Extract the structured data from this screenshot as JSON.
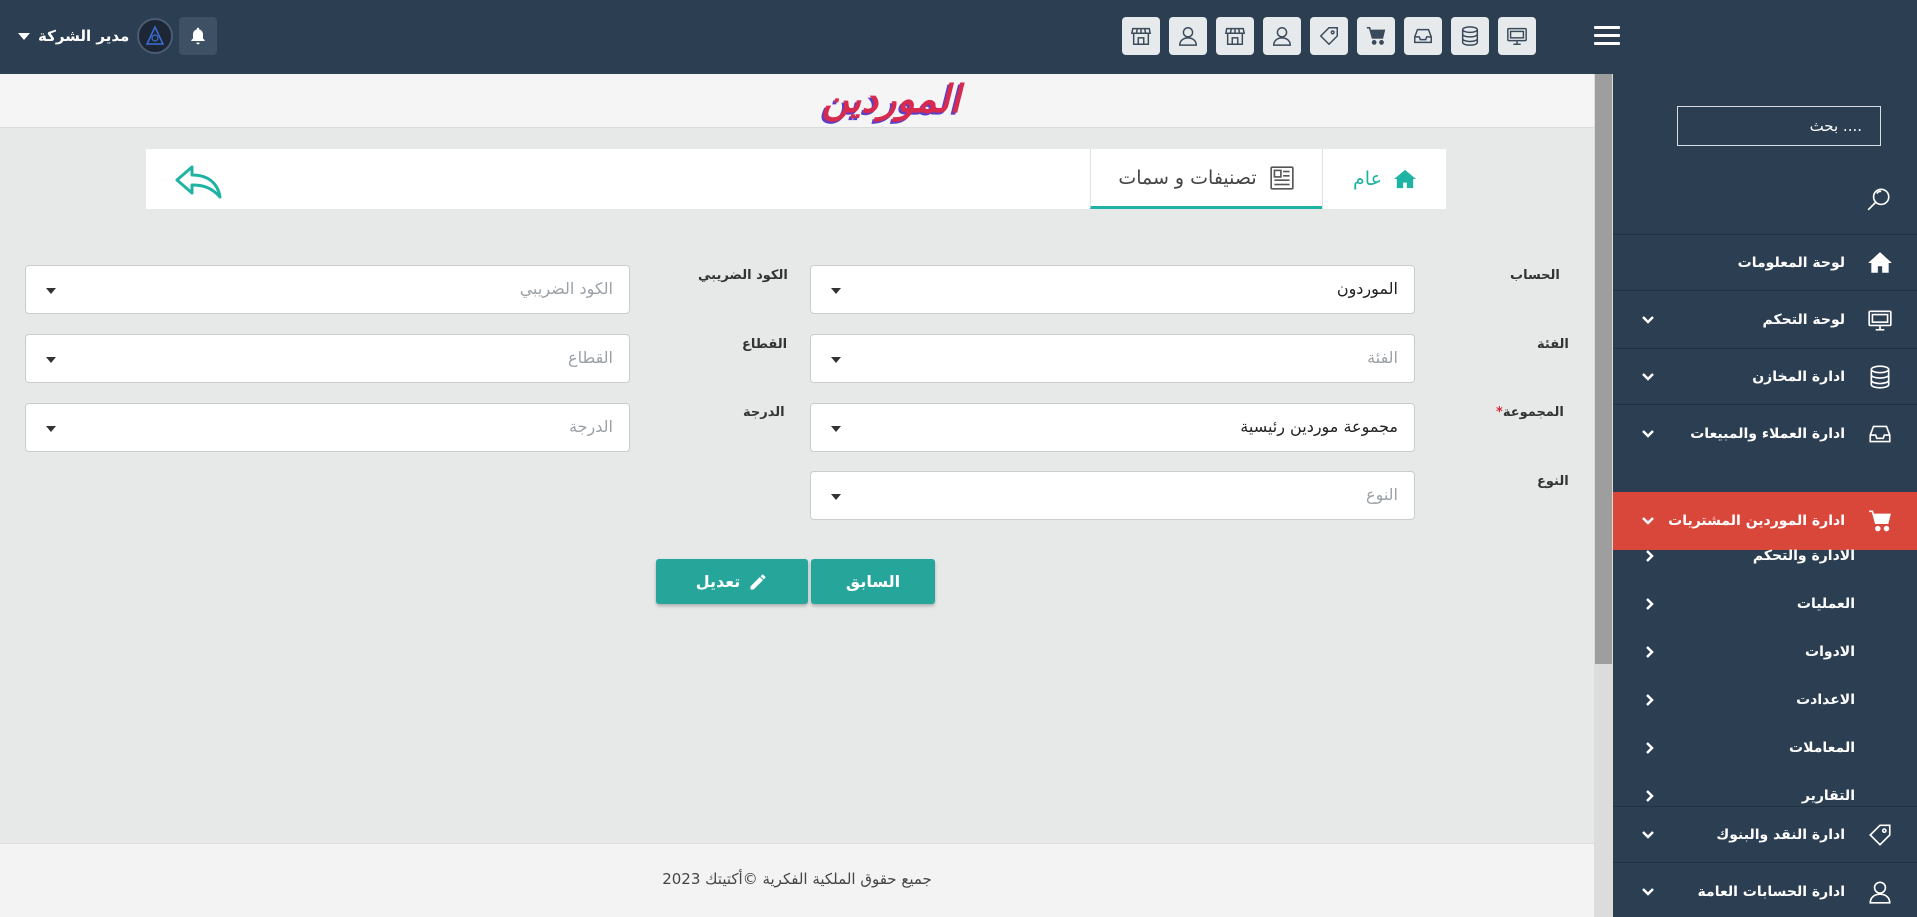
{
  "topbar": {
    "user_name": "مدير الشركة",
    "tool_icons": [
      "monitor-icon",
      "database-icon",
      "inbox-icon",
      "cart-icon",
      "tag-icon",
      "user-icon",
      "store-icon",
      "user-icon",
      "store-icon"
    ]
  },
  "page": {
    "title": "الموردين"
  },
  "tabs": {
    "general": "عام",
    "classifications": "تصنيفات و سمات"
  },
  "form": {
    "account": {
      "label": "الحساب",
      "value": "الموردون"
    },
    "category": {
      "label": "الفئة",
      "placeholder": "الفئة"
    },
    "group": {
      "label": "المجموعة",
      "required_mark": "*",
      "value": "مجموعة موردين رئيسية"
    },
    "type": {
      "label": "النوع",
      "placeholder": "النوع"
    },
    "tax_code": {
      "label": "الكود الضريبي",
      "placeholder": "الكود الضريبي"
    },
    "sector": {
      "label": "القطاع",
      "placeholder": "القطاع"
    },
    "grade": {
      "label": "الدرجة",
      "placeholder": "الدرجة"
    }
  },
  "buttons": {
    "previous": "السابق",
    "edit": "تعديل"
  },
  "footer": {
    "copyright": "جميع حقوق الملكية الفكرية ©أكتيتك 2023"
  },
  "sidebar": {
    "search_placeholder": "بحث ....",
    "items": [
      {
        "label": "لوحة المعلومات",
        "icon": "home-icon"
      },
      {
        "label": "لوحة التحكم",
        "icon": "monitor-icon"
      },
      {
        "label": "ادارة المخازن",
        "icon": "database-icon"
      },
      {
        "label": "ادارة العملاء والمبيعات",
        "icon": "inbox-icon"
      },
      {
        "label": "ادارة الموردين المشتريات",
        "icon": "cart-icon",
        "active": true
      },
      {
        "label": "ادارة النقد والبنوك",
        "icon": "tag-icon"
      },
      {
        "label": "ادارة الحسابات العامة",
        "icon": "user-icon"
      }
    ],
    "subitems": [
      "الادارة والتحكم",
      "العمليات",
      "الادوات",
      "الاعدادت",
      "المعاملات",
      "التقارير"
    ],
    "colors": {
      "background": "#2c3e52",
      "active": "#d9473a"
    }
  },
  "colors": {
    "accent": "#26a69a",
    "tab_accent": "#1fb3a3",
    "title": "#d82a4e"
  }
}
